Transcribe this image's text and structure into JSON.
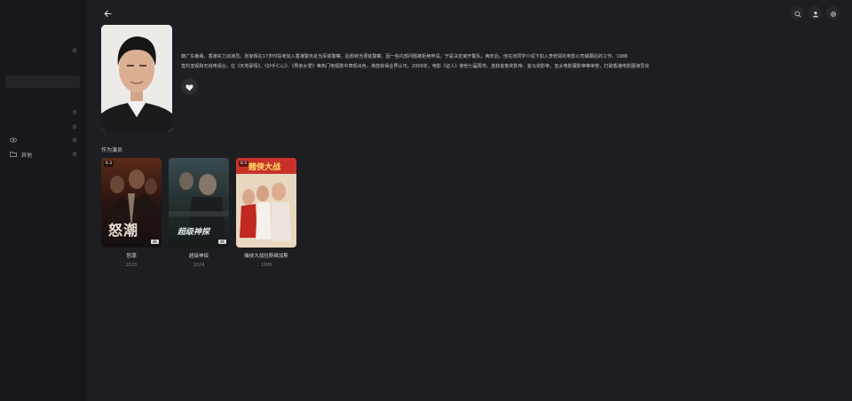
{
  "sidebar": {
    "items": [
      {
        "label": "",
        "count": "0"
      },
      {
        "label": "",
        "count": "0"
      },
      {
        "label": "",
        "count": "0"
      },
      {
        "label": "",
        "count": "0"
      },
      {
        "label": "其他",
        "count": "0",
        "icon": "folder-icon"
      }
    ]
  },
  "header": {
    "back_icon": "arrow-left-icon",
    "icons": [
      "search-icon",
      "user-icon",
      "gear-icon"
    ]
  },
  "person": {
    "bio_lines": [
      "籍广东番禺，香港实力派演员。张家辉在17岁时投考加入香港警务处当军装警察。后想转当便装警察，因一些内部问题被拒绝申请，于是决定离开警队。两年后，他在旧同学介绍下加入李修贤的电影公司做幕后的工作。1986",
      "签约亚视和无线电视台，在《天地豪情》、《妙手仁心》、《男亲女爱》等热门电视剧中表现出色，演技获得业界认可。2009年，电影《证人》使他七届再夺。连获金像奖影帝、金马奖影帝，亚太电影展影帝等荣誉，打破香港电影圈演员完"
    ]
  },
  "section": {
    "title": "作为演员"
  },
  "movies": [
    {
      "title": "怒潮",
      "year": "2023",
      "score": "6.3",
      "res": "4K",
      "poster_text": "怒潮"
    },
    {
      "title": "超级神探",
      "year": "2024",
      "score": "",
      "res": "4K",
      "poster_text": "超级神探"
    },
    {
      "title": "赌侠大战拉斯维加斯",
      "year": "1999",
      "score": "6.5",
      "res": "",
      "poster_text": "赌侠大战"
    }
  ],
  "colors": {
    "background": "#1d1e22",
    "sidebar": "#17181b",
    "text": "#d8d8d8",
    "muted": "#7d7d7d"
  }
}
